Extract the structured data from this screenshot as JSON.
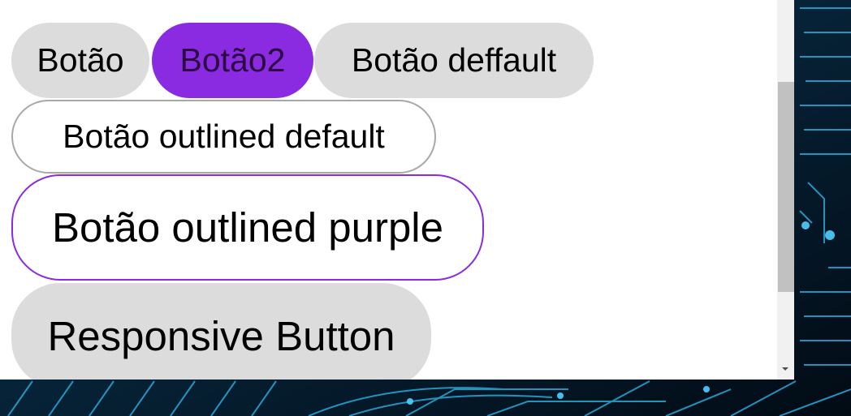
{
  "buttons": {
    "botao": "Botão",
    "botao2": "Botão2",
    "botao_default": "Botão deffault",
    "outlined_default": "Botão outlined default",
    "outlined_purple": "Botão outlined purple",
    "responsive": "Responsive Button"
  },
  "colors": {
    "purple": "#8a2be2",
    "default_bg": "#dcdcdc",
    "outline_gray": "#a8a8a8",
    "backdrop": "#03121f"
  }
}
